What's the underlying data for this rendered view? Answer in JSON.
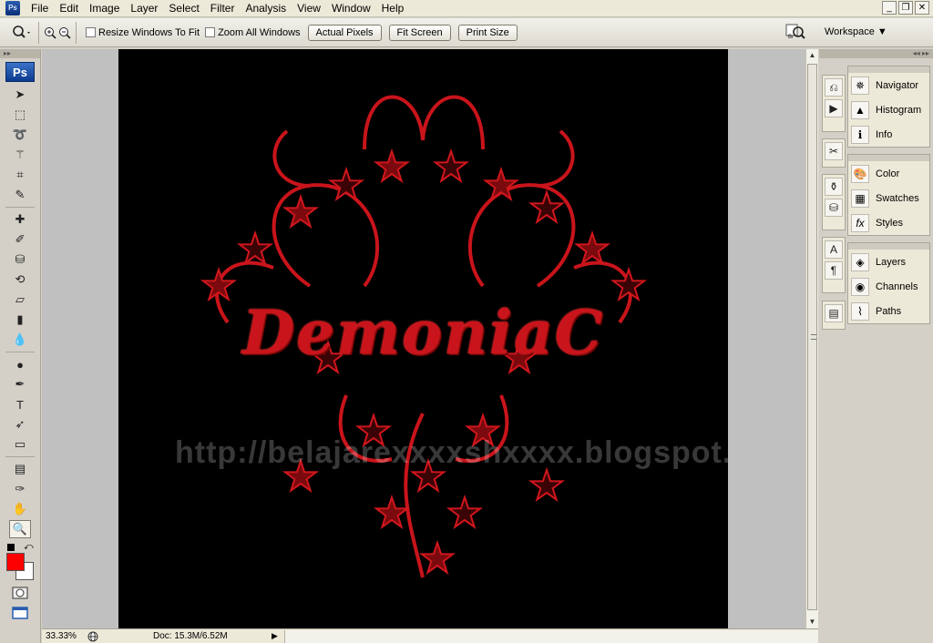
{
  "app": {
    "icon_label": "Ps"
  },
  "menu": [
    "File",
    "Edit",
    "Image",
    "Layer",
    "Select",
    "Filter",
    "Analysis",
    "View",
    "Window",
    "Help"
  ],
  "window_controls": {
    "minimize": "_",
    "restore": "❐",
    "close": "✕"
  },
  "options_bar": {
    "tool_icon": "zoom-magnifier-icon",
    "resize_windows_label": "Resize Windows To Fit",
    "zoom_all_label": "Zoom All Windows",
    "actual_pixels_label": "Actual Pixels",
    "fit_screen_label": "Fit Screen",
    "print_size_label": "Print Size",
    "bridge_label": "Br",
    "workspace_label": "Workspace ▼"
  },
  "toolbox": {
    "logo": "Ps",
    "tools": [
      {
        "name": "move-tool-icon",
        "glyph": "➤"
      },
      {
        "name": "marquee-tool-icon",
        "glyph": "⬚"
      },
      {
        "name": "lasso-tool-icon",
        "glyph": "➰"
      },
      {
        "name": "magic-wand-tool-icon",
        "glyph": "⚚"
      },
      {
        "name": "crop-tool-icon",
        "glyph": "⌗"
      },
      {
        "name": "slice-tool-icon",
        "glyph": "✎"
      },
      {
        "name": "healing-brush-tool-icon",
        "glyph": "✚"
      },
      {
        "name": "brush-tool-icon",
        "glyph": "✐"
      },
      {
        "name": "clone-stamp-tool-icon",
        "glyph": "⛁"
      },
      {
        "name": "history-brush-tool-icon",
        "glyph": "⟲"
      },
      {
        "name": "eraser-tool-icon",
        "glyph": "▱"
      },
      {
        "name": "gradient-tool-icon",
        "glyph": "▮"
      },
      {
        "name": "blur-tool-icon",
        "glyph": "💧"
      },
      {
        "name": "dodge-tool-icon",
        "glyph": "●"
      },
      {
        "name": "pen-tool-icon",
        "glyph": "✒"
      },
      {
        "name": "type-tool-icon",
        "glyph": "T"
      },
      {
        "name": "path-selection-tool-icon",
        "glyph": "➶"
      },
      {
        "name": "shape-tool-icon",
        "glyph": "▭"
      },
      {
        "name": "notes-tool-icon",
        "glyph": "▤"
      },
      {
        "name": "eyedropper-tool-icon",
        "glyph": "✑"
      },
      {
        "name": "hand-tool-icon",
        "glyph": "✋"
      },
      {
        "name": "zoom-tool-icon",
        "glyph": "🔍"
      }
    ],
    "foreground_color": "#ff0000",
    "background_color": "#ffffff"
  },
  "canvas": {
    "artwork_text": "DemoniaC",
    "watermark": "http://belajarexxxxshxxxx.blogspot.com",
    "background": "#000000"
  },
  "status_bar": {
    "zoom": "33.33%",
    "doc_info": "Doc: 15.3M/6.52M",
    "menu_arrow": "▶"
  },
  "panels": {
    "group1": [
      "Navigator",
      "Histogram",
      "Info"
    ],
    "group2": [
      "Color",
      "Swatches",
      "Styles"
    ],
    "group3": [
      "Layers",
      "Channels",
      "Paths"
    ]
  }
}
